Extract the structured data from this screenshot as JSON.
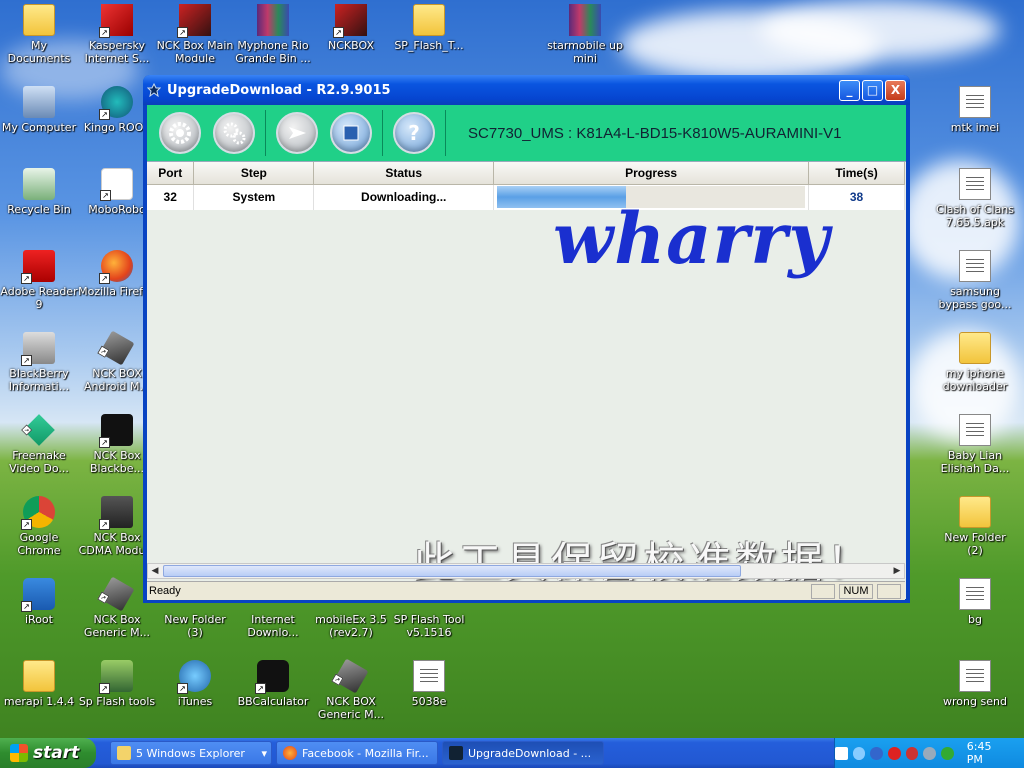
{
  "window": {
    "title": "UpgradeDownload - R2.9.9015",
    "model_text": "SC7730_UMS : K81A4-L-BD15-K810W5-AURAMINI-V1",
    "minimize": "_",
    "maximize": "□",
    "close": "X"
  },
  "toolbar": {
    "load_packet_icon": "gear-icon",
    "settings_icon": "gears-icon",
    "start_icon": "play-icon",
    "stop_icon": "stop-icon",
    "help_label": "?"
  },
  "table": {
    "headers": [
      "Port",
      "Step",
      "Status",
      "Progress",
      "Time(s)"
    ],
    "rows": [
      {
        "port": "32",
        "step": "System",
        "status": "Downloading...",
        "progress": 0.42,
        "time": "38"
      }
    ]
  },
  "watermark": "wharry",
  "notice_cn": "此工具保留校准数据！",
  "statusbar": {
    "ready": "Ready",
    "num": "NUM"
  },
  "desktop_icons": [
    {
      "label": "My Documents"
    },
    {
      "label": "Kaspersky Internet S..."
    },
    {
      "label": "NCK Box Main Module"
    },
    {
      "label": "Myphone Rio Grande Bin ..."
    },
    {
      "label": "NCKBOX"
    },
    {
      "label": "SP_Flash_T..."
    },
    {
      "label": "starmobile up mini"
    },
    {
      "label": "My Computer"
    },
    {
      "label": "Kingo ROOT"
    },
    {
      "label": "Recycle Bin"
    },
    {
      "label": "MoboRobo"
    },
    {
      "label": "Adobe Reader 9"
    },
    {
      "label": "Mozilla Firefox"
    },
    {
      "label": "BlackBerry Informati..."
    },
    {
      "label": "NCK BOX Android M..."
    },
    {
      "label": "Freemake Video Do..."
    },
    {
      "label": "NCK Box Blackbe..."
    },
    {
      "label": "Google Chrome"
    },
    {
      "label": "NCK Box CDMA Module"
    },
    {
      "label": "iRoot"
    },
    {
      "label": "NCK Box Generic M..."
    },
    {
      "label": "New Folder (3)"
    },
    {
      "label": "Internet Downlo..."
    },
    {
      "label": "mobileEx 3.5 (rev2.7)"
    },
    {
      "label": "SP Flash Tool v5.1516"
    },
    {
      "label": "merapi 1.4.4"
    },
    {
      "label": "Sp Flash tools"
    },
    {
      "label": "iTunes"
    },
    {
      "label": "BBCalculator"
    },
    {
      "label": "NCK BOX Generic M..."
    },
    {
      "label": "5038e"
    },
    {
      "label": "mtk imei"
    },
    {
      "label": "Clash of Clans 7.65.5.apk"
    },
    {
      "label": "samsung bypass goo..."
    },
    {
      "label": "my iphone downloader"
    },
    {
      "label": "Baby Lian Elishah Da..."
    },
    {
      "label": "New Folder (2)"
    },
    {
      "label": "bg"
    },
    {
      "label": "wrong send"
    }
  ],
  "taskbar": {
    "start": "start",
    "tasks": [
      {
        "label": "5 Windows Explorer"
      },
      {
        "label": "Facebook - Mozilla Fir..."
      },
      {
        "label": "UpgradeDownload - ..."
      }
    ],
    "clock": "6:45 PM"
  }
}
